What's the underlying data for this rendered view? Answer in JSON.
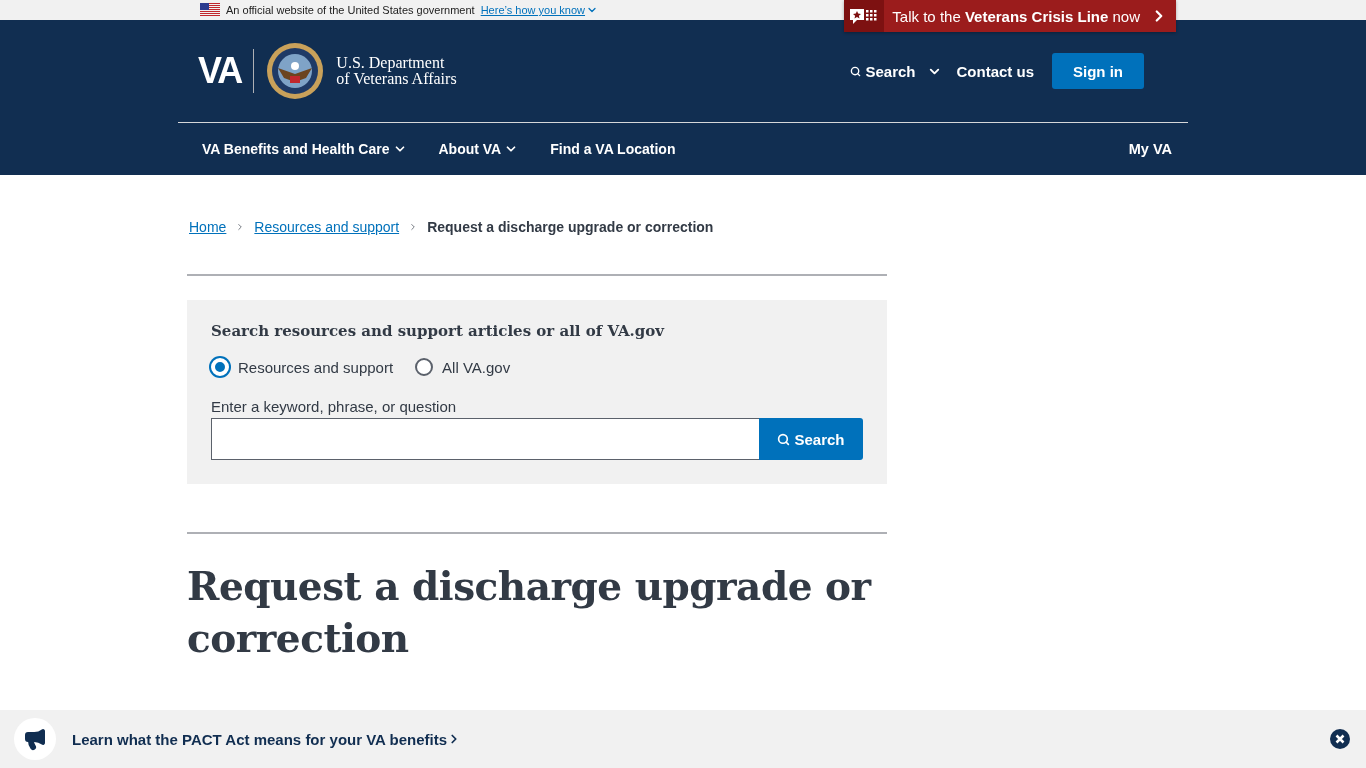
{
  "banner": {
    "text": "An official website of the United States government",
    "link": "Here’s how you know"
  },
  "crisis_line": {
    "text": "Talk to the **Veterans Crisis Line** now"
  },
  "header": {
    "logo": "VA",
    "department": [
      "U.S. Department",
      "of Veterans Affairs"
    ],
    "search": "Search",
    "contact": "Contact us",
    "sign_in": "Sign in"
  },
  "nav": {
    "items": [
      {
        "label": "VA Benefits and Health Care",
        "dropdown": true
      },
      {
        "label": "About VA",
        "dropdown": true
      },
      {
        "label": "Find a VA Location",
        "dropdown": false
      }
    ],
    "my_va": "My VA"
  },
  "breadcrumbs": [
    {
      "label": "Home",
      "current": false
    },
    {
      "label": "Resources and support",
      "current": false
    },
    {
      "label": "Request a discharge upgrade or correction",
      "current": true
    }
  ],
  "search_panel": {
    "title": "Search resources and support articles or all of VA.gov",
    "options": [
      {
        "label": "Resources and support",
        "selected": true
      },
      {
        "label": "All VA.gov",
        "selected": false
      }
    ],
    "field_label": "Enter a keyword, phrase, or question",
    "button": "Search"
  },
  "heading": "Request a discharge upgrade or correction",
  "promo": {
    "text": "Learn what the PACT Act means for your VA benefits"
  }
}
